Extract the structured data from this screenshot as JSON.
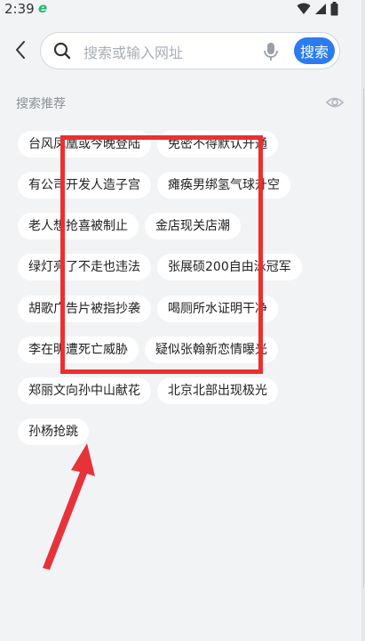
{
  "status_bar": {
    "time": "2:39",
    "app_indicator": "e"
  },
  "toolbar": {
    "search_placeholder": "搜索或输入网址",
    "search_button_label": "搜索"
  },
  "suggestions": {
    "title": "搜索推荐",
    "items": [
      "台风凤凰或今晚登陆",
      "免密不得默认开通",
      "有公司开发人造子宫",
      "瘫痪男绑氢气球升空",
      "老人想抢喜被制止",
      "金店现关店潮",
      "绿灯亮了不走也违法",
      "张展硕200自由泳冠军",
      "胡歌广告片被指抄袭",
      "喝厕所水证明干净",
      "李在明遭死亡威胁",
      "疑似张翰新恋情曝光",
      "郑丽文向孙中山献花",
      "北京北部出现极光",
      "孙杨抢跳"
    ]
  },
  "annotations": {
    "box_color": "#ec2f2f",
    "arrow_color": "#e8323a"
  },
  "colors": {
    "accent": "#2b7cf0",
    "background": "#f2f3f5"
  }
}
